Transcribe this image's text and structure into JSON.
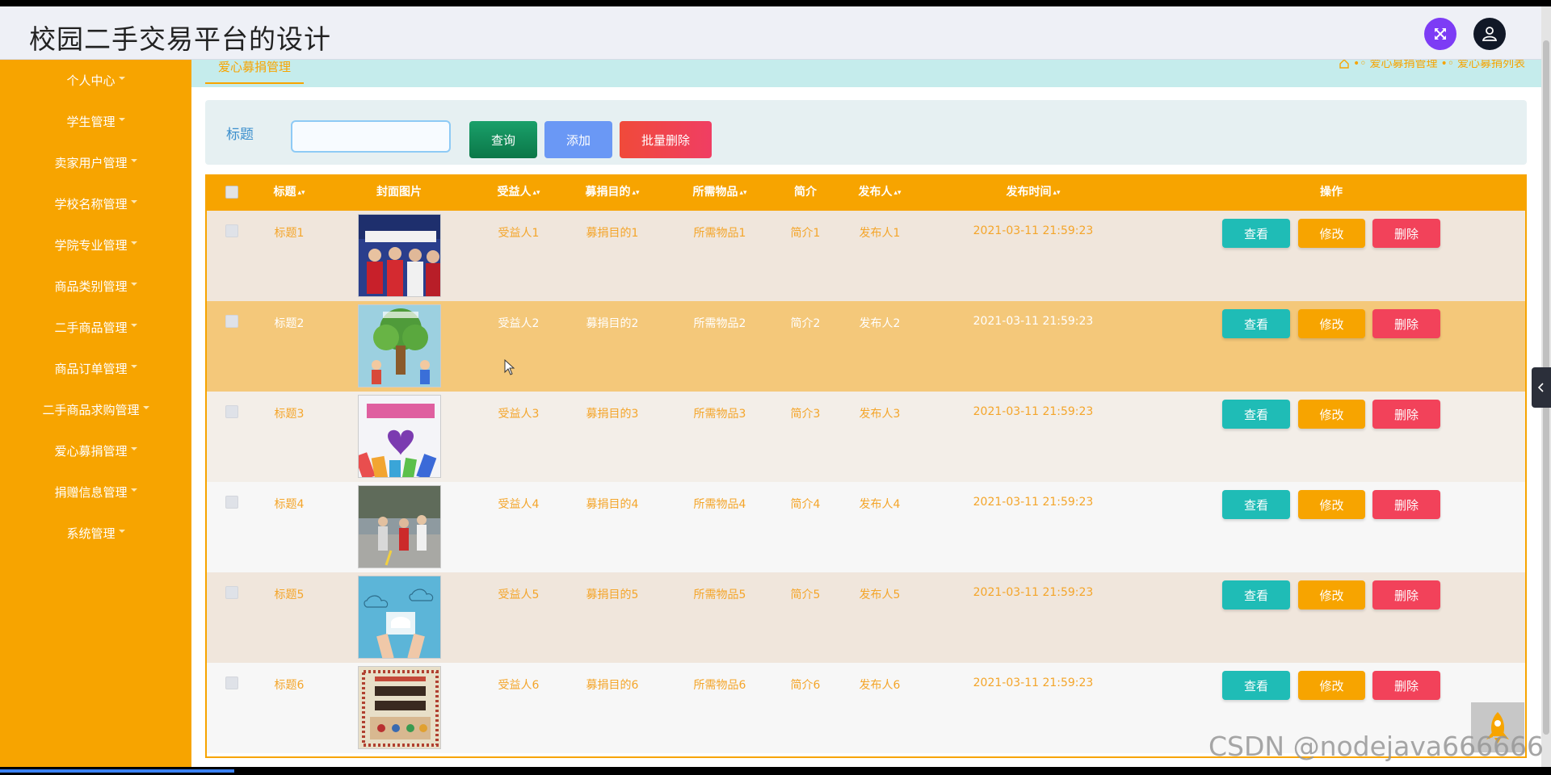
{
  "app": {
    "title": "校园二手交易平台的设计",
    "watermark": "CSDN @nodejava666666"
  },
  "header": {
    "fullscreen_icon": "fullscreen-icon",
    "user_icon": "user-icon"
  },
  "sidebar": {
    "items": [
      {
        "label": "个人中心"
      },
      {
        "label": "学生管理"
      },
      {
        "label": "卖家用户管理"
      },
      {
        "label": "学校名称管理"
      },
      {
        "label": "学院专业管理"
      },
      {
        "label": "商品类别管理"
      },
      {
        "label": "二手商品管理"
      },
      {
        "label": "商品订单管理"
      },
      {
        "label": "二手商品求购管理"
      },
      {
        "label": "爱心募捐管理"
      },
      {
        "label": "捐赠信息管理"
      },
      {
        "label": "系统管理"
      }
    ]
  },
  "breadcrumb": {
    "tab": "爱心募捐管理",
    "path": [
      "爱心募捐管理",
      "爱心募捐列表"
    ]
  },
  "search": {
    "label": "标题",
    "value": "",
    "query_label": "查询",
    "add_label": "添加",
    "batch_delete_label": "批量删除"
  },
  "table": {
    "columns": [
      "标题",
      "封面图片",
      "受益人",
      "募捐目的",
      "所需物品",
      "简介",
      "发布人",
      "发布时间",
      "操作"
    ],
    "rows": [
      {
        "title": "标题1",
        "beneficiary": "受益人1",
        "purpose": "募捐目的1",
        "items": "所需物品1",
        "intro": "简介1",
        "publisher": "发布人1",
        "time": "2021-03-11 21:59:23"
      },
      {
        "title": "标题2",
        "beneficiary": "受益人2",
        "purpose": "募捐目的2",
        "items": "所需物品2",
        "intro": "简介2",
        "publisher": "发布人2",
        "time": "2021-03-11 21:59:23"
      },
      {
        "title": "标题3",
        "beneficiary": "受益人3",
        "purpose": "募捐目的3",
        "items": "所需物品3",
        "intro": "简介3",
        "publisher": "发布人3",
        "time": "2021-03-11 21:59:23"
      },
      {
        "title": "标题4",
        "beneficiary": "受益人4",
        "purpose": "募捐目的4",
        "items": "所需物品4",
        "intro": "简介4",
        "publisher": "发布人4",
        "time": "2021-03-11 21:59:23"
      },
      {
        "title": "标题5",
        "beneficiary": "受益人5",
        "purpose": "募捐目的5",
        "items": "所需物品5",
        "intro": "简介5",
        "publisher": "发布人5",
        "time": "2021-03-11 21:59:23"
      },
      {
        "title": "标题6",
        "beneficiary": "受益人6",
        "purpose": "募捐目的6",
        "items": "所需物品6",
        "intro": "简介6",
        "publisher": "发布人6",
        "time": "2021-03-11 21:59:23"
      }
    ],
    "actions": {
      "view": "查看",
      "edit": "修改",
      "delete": "删除"
    }
  },
  "colors": {
    "accent": "#f7a400",
    "sidebar": "#f7a400",
    "view_button": "#1fbcb6",
    "delete_button": "#f2425a",
    "row_backgrounds": [
      "#f0e6dc",
      "#f4c87a",
      "#f3eee8",
      "#f7f7f7",
      "#f0e6dc",
      "#f7f7f7"
    ]
  }
}
